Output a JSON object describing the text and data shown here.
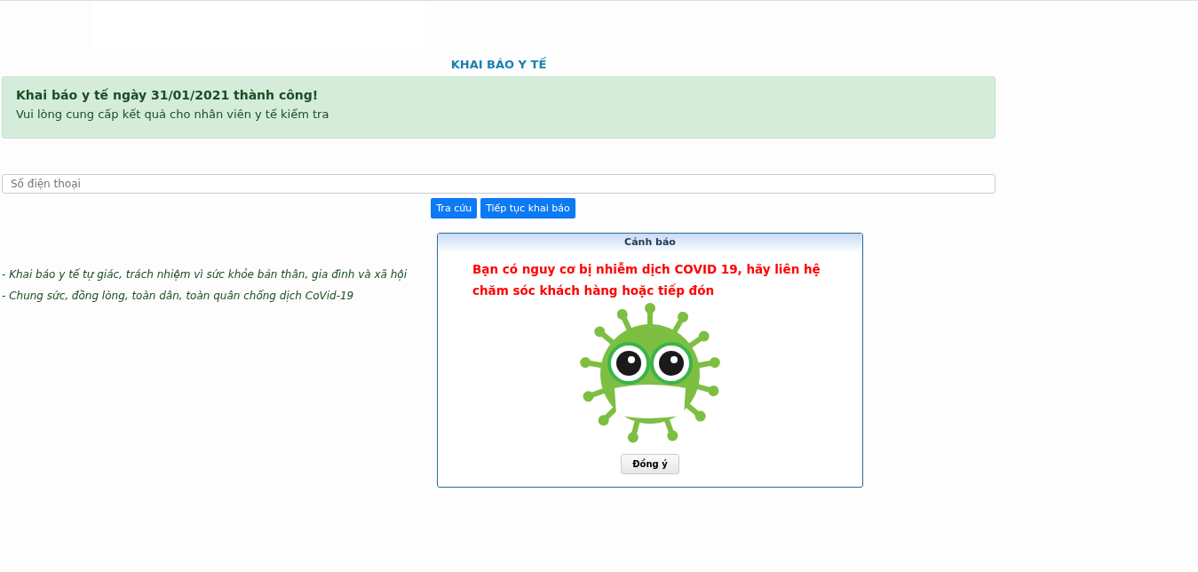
{
  "page": {
    "title": "KHAI BÁO Y TẾ"
  },
  "alert": {
    "heading": "Khai báo y tế ngày 31/01/2021 thành công!",
    "message": "Vui lòng cung cấp kết quả cho nhân viên y tế kiểm tra"
  },
  "phone_field": {
    "placeholder": "Số điện thoại"
  },
  "buttons": [
    "Tra cứu",
    "Tiếp tục khai báo"
  ],
  "slogans": [
    "- Khai báo y tế tự giác, trách nhiệm vì sức khỏe bản thân, gia đình và xã hội",
    "- Chung sức, đồng lòng, toàn dân, toàn quân chống dịch CoVid-19"
  ],
  "dialog": {
    "title": "Cảnh báo",
    "message": "Bạn có nguy cơ bị nhiễm dịch COVID 19, hãy liên hệ chăm sóc khách hàng hoặc tiếp đón",
    "button": "Đồng ý"
  }
}
